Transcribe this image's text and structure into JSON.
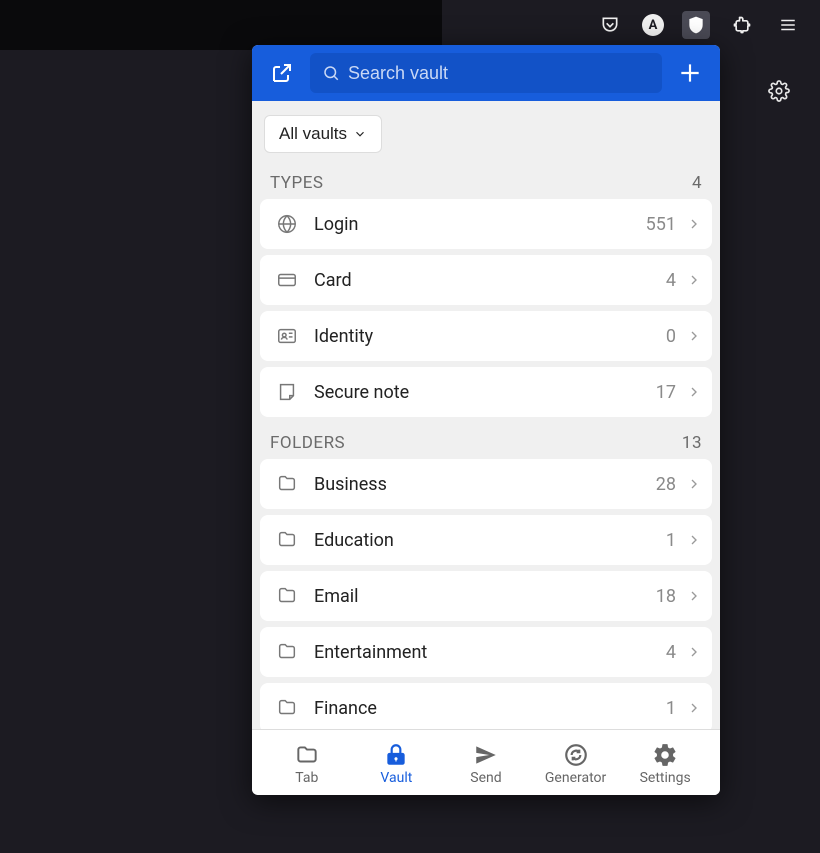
{
  "search": {
    "placeholder": "Search vault"
  },
  "filter": {
    "label": "All vaults"
  },
  "sections": {
    "types": {
      "header": "TYPES",
      "count": 4
    },
    "folders": {
      "header": "FOLDERS",
      "count": 13
    }
  },
  "types": [
    {
      "label": "Login",
      "count": 551,
      "icon": "globe"
    },
    {
      "label": "Card",
      "count": 4,
      "icon": "card"
    },
    {
      "label": "Identity",
      "count": 0,
      "icon": "identity"
    },
    {
      "label": "Secure note",
      "count": 17,
      "icon": "note"
    }
  ],
  "folders": [
    {
      "label": "Business",
      "count": 28
    },
    {
      "label": "Education",
      "count": 1
    },
    {
      "label": "Email",
      "count": 18
    },
    {
      "label": "Entertainment",
      "count": 4
    },
    {
      "label": "Finance",
      "count": 1
    }
  ],
  "nav": {
    "tab": "Tab",
    "vault": "Vault",
    "send": "Send",
    "generator": "Generator",
    "settings": "Settings"
  }
}
